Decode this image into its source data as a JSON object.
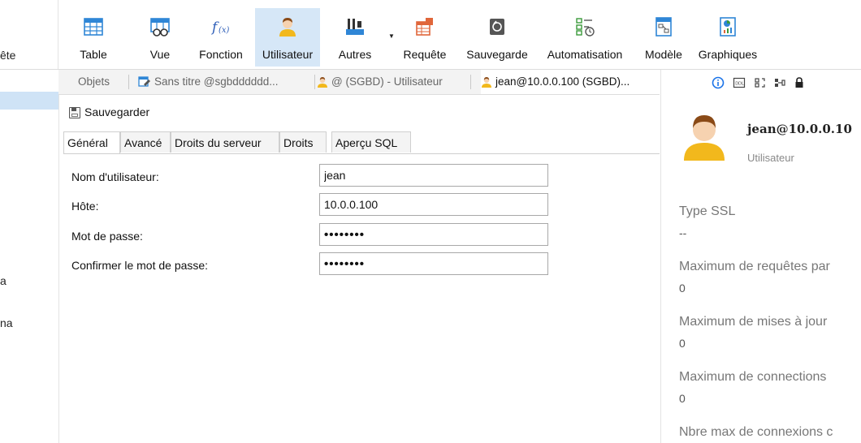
{
  "toolbar": {
    "left_fragment": "ête",
    "buttons": [
      {
        "id": "table",
        "label": "Table"
      },
      {
        "id": "vue",
        "label": "Vue"
      },
      {
        "id": "fonction",
        "label": "Fonction"
      },
      {
        "id": "utilisateur",
        "label": "Utilisateur",
        "active": true
      },
      {
        "id": "autres",
        "label": "Autres"
      },
      {
        "id": "requete",
        "label": "Requête"
      },
      {
        "id": "sauvegarde",
        "label": "Sauvegarde"
      },
      {
        "id": "automatisation",
        "label": "Automatisation"
      },
      {
        "id": "modele",
        "label": "Modèle"
      },
      {
        "id": "graphiques",
        "label": "Graphiques"
      }
    ]
  },
  "sidebar": {
    "fragment_1": "a",
    "fragment_2": "na"
  },
  "tabs": {
    "objects": "Objets",
    "tab1": "Sans titre @sgbdddddd...",
    "tab2": "@ (SGBD) - Utilisateur",
    "tab3": "jean@10.0.0.100 (SGBD)..."
  },
  "editor": {
    "save_label": "Sauvegarder",
    "subtabs": [
      "Général",
      "Avancé",
      "Droits du serveur",
      "Droits",
      "Aperçu SQL"
    ],
    "fields": {
      "username_label": "Nom d'utilisateur:",
      "username_value": "jean",
      "host_label": "Hôte:",
      "host_value": "10.0.0.100",
      "password_label": "Mot de passe:",
      "password_value": "••••••••",
      "confirm_label": "Confirmer le mot de passe:",
      "confirm_value": "••••••••"
    }
  },
  "info_panel": {
    "icons": [
      "info-icon",
      "ddl-icon",
      "preview-icon",
      "dependency-icon",
      "lock-icon"
    ],
    "title": "jean@10.0.0.10",
    "object_type": "Utilisateur",
    "properties": [
      {
        "label": "Type SSL",
        "value": "--"
      },
      {
        "label": "Maximum de requêtes par",
        "value": "0"
      },
      {
        "label": "Maximum de mises à jour",
        "value": "0"
      },
      {
        "label": "Maximum de connections",
        "value": "0"
      },
      {
        "label": "Nbre max de connexions c",
        "value": ""
      }
    ]
  },
  "colors": {
    "active_button_bg": "#d6e7f7",
    "selection_bg": "#cfe3f6",
    "user_icon_shirt": "#f2b81c",
    "user_icon_hair": "#8a4a17",
    "info_icon": "#1a73e8"
  }
}
